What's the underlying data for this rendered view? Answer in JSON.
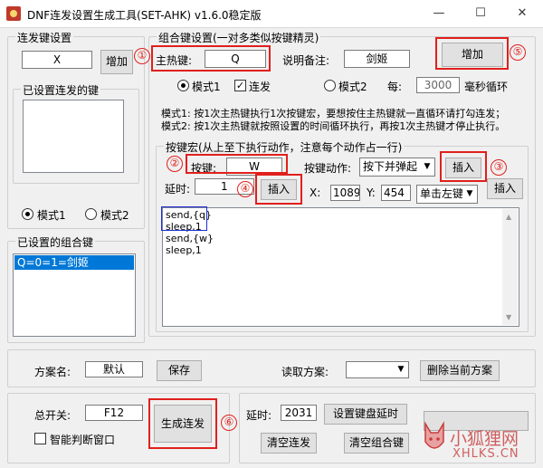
{
  "window": {
    "title": "DNF连发设置生成工具(SET-AHK) v1.6.0稳定版",
    "minimize": "—",
    "maximize": "☐",
    "close": "✕"
  },
  "rapid": {
    "group_title": "连发键设置",
    "key_value": "X",
    "add_button": "增加",
    "configured_title": "已设置连发的键",
    "mode1": "模式1",
    "mode2": "模式2",
    "mode1_selected": true
  },
  "combo_list": {
    "group_title": "已设置的组合键",
    "items": [
      "Q=0=1=剑姬"
    ]
  },
  "combo": {
    "group_title": "组合键设置(一对多类似按键精灵)",
    "hotkey_label": "主热键:",
    "hotkey_value": "Q",
    "note_label": "说明备注:",
    "note_value": "剑姬",
    "add_button": "增加",
    "mode1": "模式1",
    "rapid_label": "连发",
    "mode2": "模式2",
    "every_label": "每:",
    "interval_value": "3000",
    "interval_unit": "毫秒循环",
    "desc1": "模式1: 按1次主热键执行1次按键宏，要想按住主热键就一直循环请打勾连发；",
    "desc2": "模式2: 按1次主热键就按照设置的时间循环执行，再按1次主热键才停止执行。"
  },
  "macro": {
    "group_title": "按键宏(从上至下执行动作，注意每个动作占一行)",
    "key_label": "按键:",
    "key_value": "W",
    "action_label": "按键动作:",
    "action_value": "按下并弹起",
    "insert_key_button": "插入",
    "delay_label": "延时:",
    "delay_value": "1",
    "insert_delay_button": "插入",
    "x_label": "X:",
    "x_value": "1089",
    "y_label": "Y:",
    "y_value": "454",
    "click_value": "单击左键",
    "insert_click_button": "插入",
    "script_lines": [
      "send,{q}",
      "sleep,1",
      "send,{w}",
      "sleep,1"
    ]
  },
  "scheme": {
    "name_label": "方案名:",
    "name_value": "默认",
    "save_button": "保存",
    "read_label": "读取方案:",
    "read_value": "",
    "delete_button": "删除当前方案"
  },
  "bottom": {
    "master_label": "总开关:",
    "master_value": "F12",
    "smart_label": "智能判断窗口",
    "generate_button": "生成连发",
    "delay_label": "延时:",
    "delay_value": "2031",
    "set_delay_button": "设置键盘延时",
    "clear_rapid_button": "清空连发",
    "clear_combo_button": "清空组合键"
  },
  "annotations": [
    "①",
    "②",
    "③",
    "④",
    "⑤",
    "⑥"
  ],
  "watermark": {
    "cn": "小狐狸网",
    "en": "XHLKS.CN"
  },
  "colors": {
    "annotation_red": "#e0201c",
    "annotation_blue": "#1c2ed6",
    "selection": "#0078d7"
  }
}
